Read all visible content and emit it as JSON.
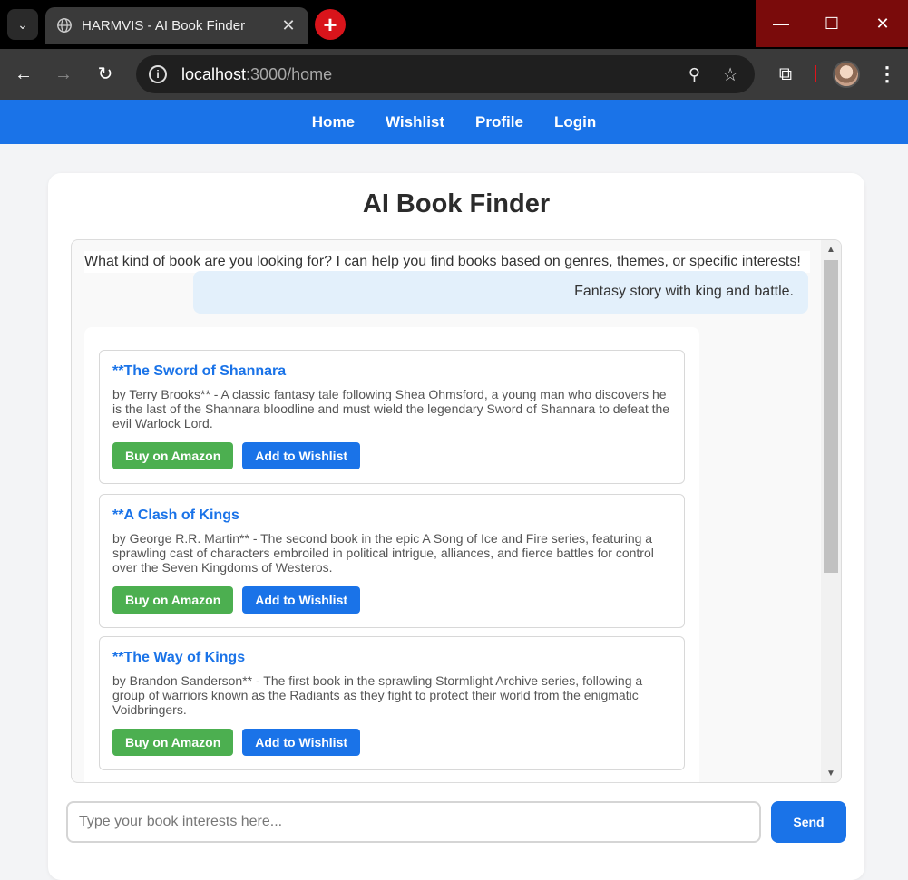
{
  "browser": {
    "tab_title": "HARMVIS - AI Book Finder",
    "url_host": "localhost",
    "url_path": ":3000/home"
  },
  "nav": {
    "items": [
      {
        "label": "Home"
      },
      {
        "label": "Wishlist"
      },
      {
        "label": "Profile"
      },
      {
        "label": "Login"
      }
    ]
  },
  "page": {
    "title": "AI Book Finder"
  },
  "chat": {
    "bot_greeting": "What kind of book are you looking for? I can help you find books based on genres, themes, or specific interests!",
    "user_message": "Fantasy story with king and battle.",
    "books": [
      {
        "title": "**The Sword of Shannara",
        "description": "by Terry Brooks** - A classic fantasy tale following Shea Ohmsford, a young man who discovers he is the last of the Shannara bloodline and must wield the legendary Sword of Shannara to defeat the evil Warlock Lord.",
        "amazon_label": "Buy on Amazon",
        "wishlist_label": "Add to Wishlist"
      },
      {
        "title": "**A Clash of Kings",
        "description": "by George R.R. Martin** - The second book in the epic A Song of Ice and Fire series, featuring a sprawling cast of characters embroiled in political intrigue, alliances, and fierce battles for control over the Seven Kingdoms of Westeros.",
        "amazon_label": "Buy on Amazon",
        "wishlist_label": "Add to Wishlist"
      },
      {
        "title": "**The Way of Kings",
        "description": "by Brandon Sanderson** - The first book in the sprawling Stormlight Archive series, following a group of warriors known as the Radiants as they fight to protect their world from the enigmatic Voidbringers.",
        "amazon_label": "Buy on Amazon",
        "wishlist_label": "Add to Wishlist"
      }
    ]
  },
  "input": {
    "placeholder": "Type your book interests here...",
    "value": "",
    "send_label": "Send"
  },
  "colors": {
    "accent": "#1a73e8",
    "amazon_green": "#4caf50"
  }
}
